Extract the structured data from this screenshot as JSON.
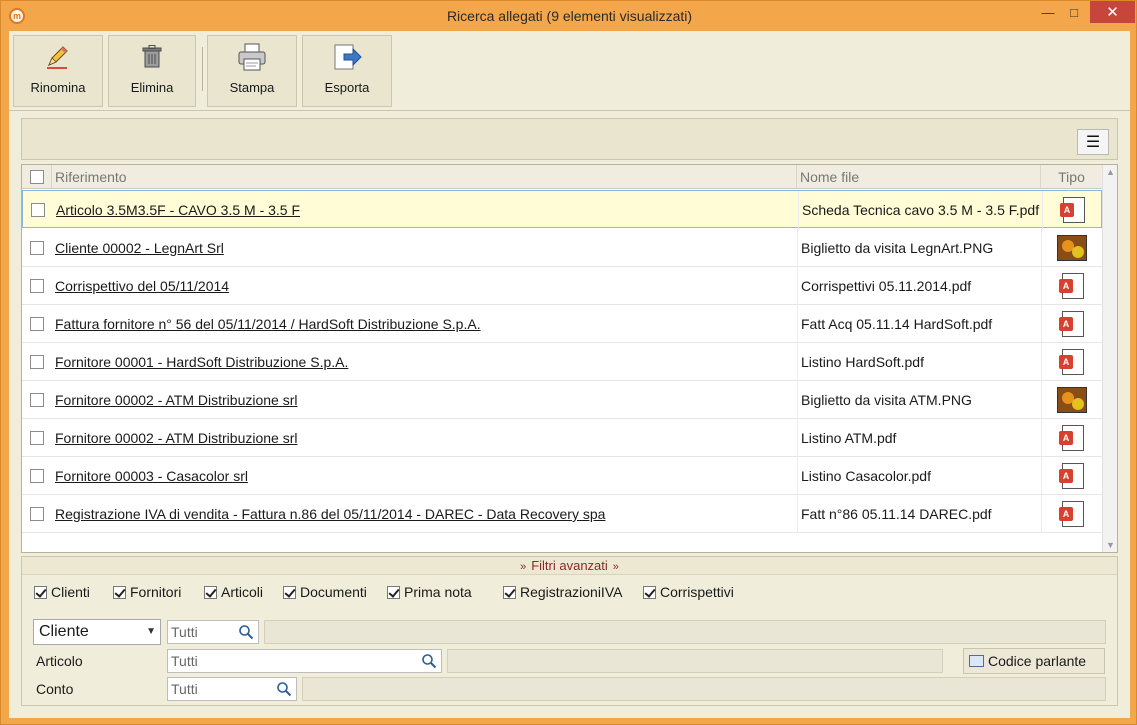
{
  "window": {
    "title": "Ricerca allegati (9 elementi visualizzati)",
    "minimize": "—",
    "maximize": "□",
    "close": "✕"
  },
  "toolbar": {
    "rename_label": "Rinomina",
    "delete_label": "Elimina",
    "print_label": "Stampa",
    "export_label": "Esporta"
  },
  "menu_button": "☰",
  "grid": {
    "headers": {
      "riferimento": "Riferimento",
      "nome_file": "Nome file",
      "tipo": "Tipo"
    },
    "rows": [
      {
        "riferimento": "Articolo 3.5M3.5F - CAVO 3.5 M - 3.5 F",
        "nome_file": "Scheda Tecnica cavo 3.5 M - 3.5 F.pdf",
        "tipo": "pdf-icon"
      },
      {
        "riferimento": "Cliente 00002 - LegnArt Srl",
        "nome_file": "Biglietto da visita LegnArt.PNG",
        "tipo": "png-icon"
      },
      {
        "riferimento": "Corrispettivo del 05/11/2014",
        "nome_file": "Corrispettivi 05.11.2014.pdf",
        "tipo": "pdf-icon"
      },
      {
        "riferimento": "Fattura fornitore n° 56 del 05/11/2014 / HardSoft Distribuzione S.p.A.",
        "nome_file": "Fatt Acq 05.11.14 HardSoft.pdf",
        "tipo": "pdf-icon"
      },
      {
        "riferimento": "Fornitore 00001 - HardSoft Distribuzione S.p.A.",
        "nome_file": "Listino HardSoft.pdf",
        "tipo": "pdf-icon"
      },
      {
        "riferimento": "Fornitore 00002 - ATM Distribuzione srl",
        "nome_file": "Biglietto da visita ATM.PNG",
        "tipo": "png-icon"
      },
      {
        "riferimento": "Fornitore 00002 - ATM Distribuzione srl",
        "nome_file": "Listino ATM.pdf",
        "tipo": "pdf-icon"
      },
      {
        "riferimento": "Fornitore 00003 - Casacolor srl",
        "nome_file": "Listino Casacolor.pdf",
        "tipo": "pdf-icon"
      },
      {
        "riferimento": "Registrazione IVA di vendita - Fattura n.86 del 05/11/2014 - DAREC - Data Recovery spa",
        "nome_file": "Fatt n°86 05.11.14 DAREC.pdf",
        "tipo": "pdf-icon"
      }
    ]
  },
  "filters": {
    "title": "Filtri avanzati",
    "checkboxes": {
      "clienti": "Clienti",
      "fornitori": "Fornitori",
      "articoli": "Articoli",
      "documenti": "Documenti",
      "prima_nota": "Prima nota",
      "registrazioni_iva": "RegistrazioniIVA",
      "corrispettivi": "Corrispettivi"
    },
    "cliente_select": "Cliente",
    "cliente_input": "Tutti",
    "articolo_label": "Articolo",
    "articolo_input": "Tutti",
    "conto_label": "Conto",
    "conto_input": "Tutti",
    "codice_parlante": "Codice parlante"
  },
  "colors": {
    "frame": "#f3a64a",
    "close": "#c7463b",
    "client_bg": "#f1eddb",
    "selected_row": "#fffcd6",
    "filters_title": "#8b2a2a"
  }
}
